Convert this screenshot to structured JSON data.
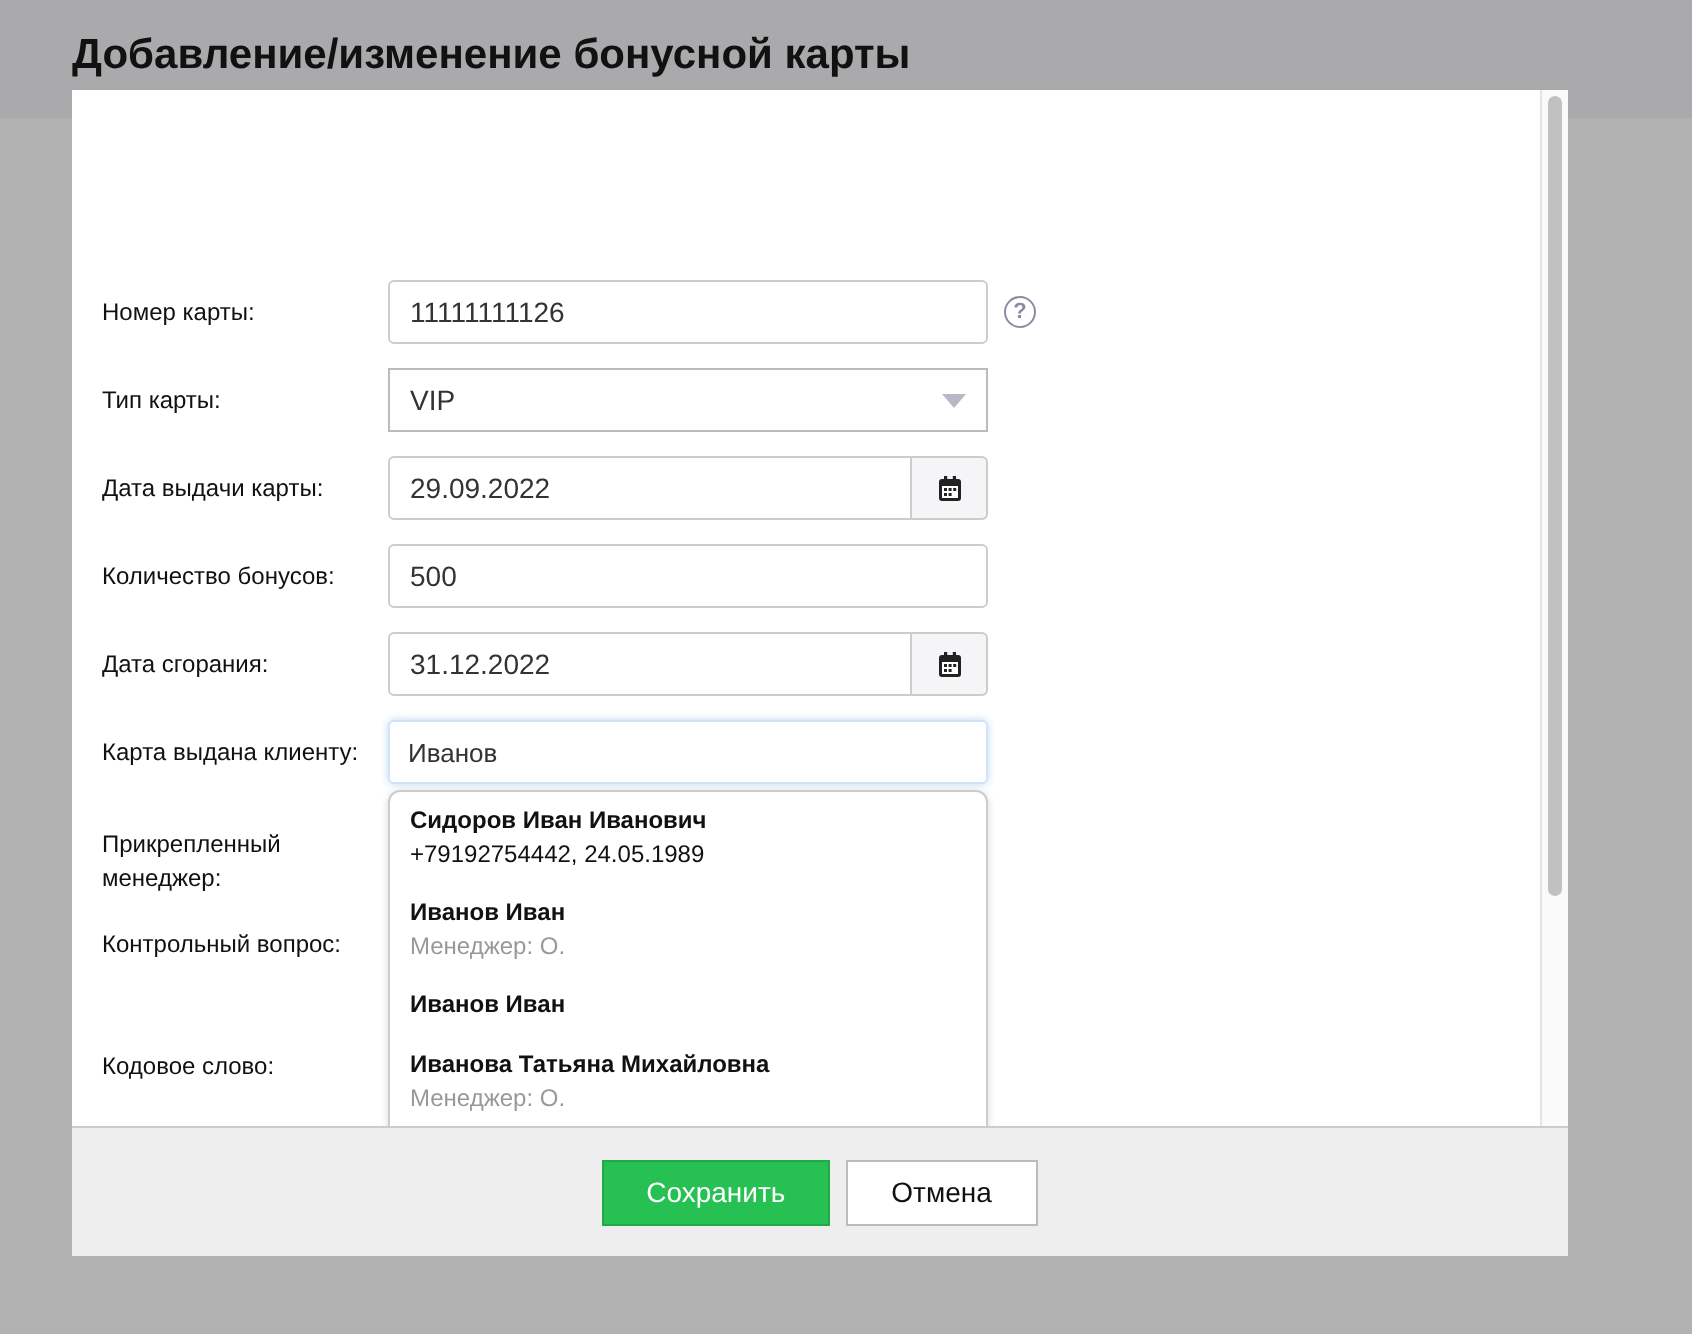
{
  "dialog": {
    "title": "Добавление/изменение бонусной карты"
  },
  "fields": [
    {
      "kind": "text",
      "label": "Номер карты:",
      "value": "11111111126",
      "help": "?"
    },
    {
      "kind": "select",
      "label": "Тип карты:",
      "value": "VIP"
    },
    {
      "kind": "date",
      "label": "Дата выдачи карты:",
      "value": "29.09.2022"
    },
    {
      "kind": "text",
      "label": "Количество бонусов:",
      "value": "500"
    },
    {
      "kind": "date",
      "label": "Дата сгорания:",
      "value": "31.12.2022"
    },
    {
      "kind": "search",
      "label": "Карта выдана клиенту:",
      "value": "Иванов",
      "focused": true
    },
    {
      "kind": "hidden",
      "label": "Прикрепленный менеджер:"
    },
    {
      "kind": "hidden",
      "label": "Контрольный вопрос:"
    },
    {
      "kind": "hidden",
      "label": "Кодовое слово:"
    }
  ],
  "suggestions": [
    {
      "name": "Сидоров Иван Иванович",
      "detail": "+79192754442, 24.05.1989",
      "muted": false
    },
    {
      "name": "Иванов Иван",
      "detail": "Менеджер: О.",
      "muted": true
    },
    {
      "name": "Иванов Иван"
    },
    {
      "name": "Иванова Татьяна Михайловна",
      "detail": "Менеджер: О.",
      "muted": true
    }
  ],
  "buttons": [
    {
      "label": "Сохранить",
      "primary": true
    },
    {
      "label": "Отмена",
      "primary": false
    }
  ]
}
